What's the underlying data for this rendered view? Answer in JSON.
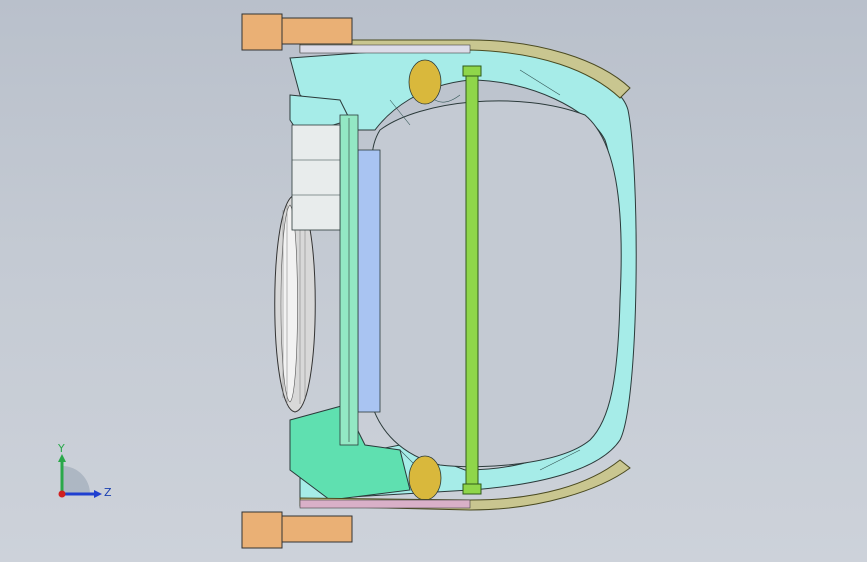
{
  "viewport": {
    "background_top": "#b9c0cb",
    "background_bottom": "#cdd2da"
  },
  "model": {
    "colors": {
      "panel_cyan": "#a6ece8",
      "panel_green": "#5fe0b0",
      "panel_blue": "#a9c4f2",
      "bar_green": "#8fd64a",
      "bracket_yellow": "#d9b83c",
      "block_orange": "#eab075",
      "bumper_olive": "#c9c690",
      "bumper_pink": "#d9b0c8",
      "tire_light": "#ebebeb",
      "edge_dark": "#2b3a3a"
    }
  },
  "triad": {
    "y_label": "Y",
    "z_label": "Z",
    "y_color": "#2aa84a",
    "z_color": "#1f3fd0",
    "x_color": "#d02020"
  }
}
